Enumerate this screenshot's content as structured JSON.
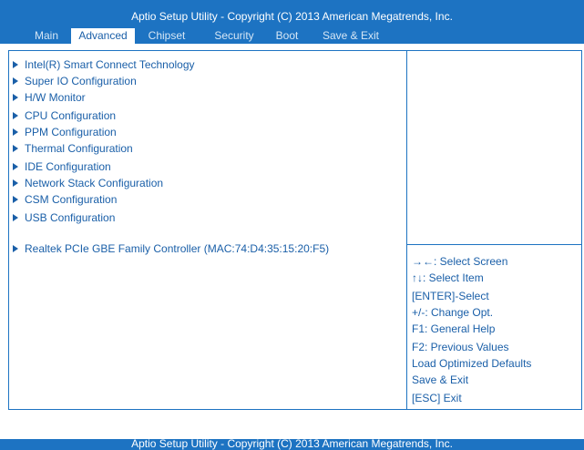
{
  "header": {
    "title": "Aptio Setup Utility - Copyright  (C)  2013 American Megatrends, Inc.",
    "tabs": [
      {
        "label": "Main"
      },
      {
        "label": "Advanced"
      },
      {
        "label": "Chipset"
      },
      {
        "label": "Security"
      },
      {
        "label": "Boot"
      },
      {
        "label": "Save & Exit"
      }
    ],
    "active_tab": "Advanced"
  },
  "menu": {
    "items": [
      {
        "label": "Intel(R) Smart Connect Technology"
      },
      {
        "label": "Super IO Configuration"
      },
      {
        "label": "H/W Monitor"
      },
      {
        "label": "CPU Configuration"
      },
      {
        "label": "PPM Configuration"
      },
      {
        "label": "Thermal Configuration"
      },
      {
        "label": "IDE Configuration"
      },
      {
        "label": "Network Stack Configuration"
      },
      {
        "label": "CSM Configuration"
      },
      {
        "label": "USB Configuration"
      },
      {
        "label": "Realtek PCIe GBE Family Controller  (MAC:74:D4:35:15:20:F5)"
      }
    ]
  },
  "help": {
    "lines": [
      "→←: Select Screen",
      "↑↓: Select Item",
      "[ENTER]-Select",
      "+/-: Change Opt.",
      "F1: General Help",
      "F2: Previous Values",
      "Load Optimized Defaults",
      "Save & Exit",
      "[ESC] Exit"
    ]
  },
  "footer": {
    "text": "Aptio Setup Utility - Copyright  (C)  2013 American Megatrends, Inc."
  },
  "colors": {
    "bar": "#1d73c2",
    "text": "#1a5fa8",
    "background": "#ffffff"
  }
}
